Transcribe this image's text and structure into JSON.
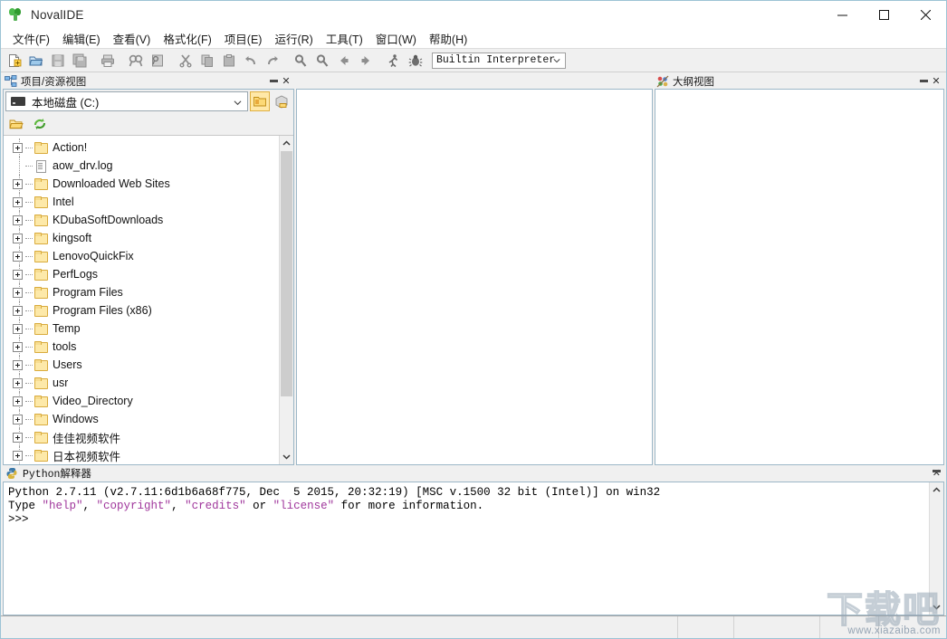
{
  "window": {
    "title": "NovalIDE",
    "app_icon": "sprout-icon",
    "controls": {
      "minimize": "–",
      "maximize": "□",
      "close": "✕"
    }
  },
  "menubar": {
    "items": [
      {
        "label": "文件(F)",
        "name": "menu-file"
      },
      {
        "label": "编辑(E)",
        "name": "menu-edit"
      },
      {
        "label": "查看(V)",
        "name": "menu-view"
      },
      {
        "label": "格式化(F)",
        "name": "menu-format"
      },
      {
        "label": "项目(E)",
        "name": "menu-project"
      },
      {
        "label": "运行(R)",
        "name": "menu-run"
      },
      {
        "label": "工具(T)",
        "name": "menu-tools"
      },
      {
        "label": "窗口(W)",
        "name": "menu-window"
      },
      {
        "label": "帮助(H)",
        "name": "menu-help"
      }
    ]
  },
  "toolbar": {
    "buttons": [
      {
        "icon": "new-file-icon",
        "name": "toolbar-new-file"
      },
      {
        "icon": "open-folder-icon",
        "name": "toolbar-open"
      },
      {
        "icon": "save-icon",
        "name": "toolbar-save"
      },
      {
        "icon": "save-all-icon",
        "name": "toolbar-save-all"
      },
      {
        "icon": "print-icon",
        "name": "toolbar-print"
      },
      {
        "icon": "find-icon",
        "name": "toolbar-find"
      },
      {
        "icon": "replace-icon",
        "name": "toolbar-replace"
      },
      {
        "icon": "cut-icon",
        "name": "toolbar-cut"
      },
      {
        "icon": "copy-icon",
        "name": "toolbar-copy"
      },
      {
        "icon": "paste-icon",
        "name": "toolbar-paste"
      },
      {
        "icon": "undo-icon",
        "name": "toolbar-undo"
      },
      {
        "icon": "redo-icon",
        "name": "toolbar-redo"
      },
      {
        "icon": "zoom-in-icon",
        "name": "toolbar-zoom-in"
      },
      {
        "icon": "zoom-out-icon",
        "name": "toolbar-zoom-out"
      },
      {
        "icon": "back-arrow-icon",
        "name": "toolbar-back"
      },
      {
        "icon": "forward-arrow-icon",
        "name": "toolbar-forward"
      },
      {
        "icon": "run-icon",
        "name": "toolbar-run"
      },
      {
        "icon": "debug-bug-icon",
        "name": "toolbar-debug"
      }
    ],
    "interpreter": {
      "value": "Builtin Interpreter",
      "arrow_icon": "chevron-down-icon"
    }
  },
  "project_panel": {
    "title": "项目/资源视图",
    "icon": "project-view-icon",
    "minimize": "minimize-icon",
    "close": "close-icon",
    "drive": {
      "value": "本地磁盘 (C:)",
      "icon": "drive-icon",
      "arrow_icon": "chevron-down-icon"
    },
    "drive_buttons": [
      {
        "icon": "folder-yellow-icon",
        "name": "drive-browse-button",
        "selected": true
      },
      {
        "icon": "package-icon",
        "name": "drive-package-button",
        "selected": false
      }
    ],
    "mini_toolbar": [
      {
        "icon": "open-folder-icon",
        "name": "tree-open-folder-button"
      },
      {
        "icon": "refresh-icon",
        "name": "tree-refresh-button"
      }
    ],
    "tree": [
      {
        "label": "Action!",
        "type": "folder",
        "expandable": true
      },
      {
        "label": "aow_drv.log",
        "type": "file",
        "expandable": false
      },
      {
        "label": "Downloaded Web Sites",
        "type": "folder",
        "expandable": true
      },
      {
        "label": "Intel",
        "type": "folder",
        "expandable": true
      },
      {
        "label": "KDubaSoftDownloads",
        "type": "folder",
        "expandable": true
      },
      {
        "label": "kingsoft",
        "type": "folder",
        "expandable": true
      },
      {
        "label": "LenovoQuickFix",
        "type": "folder",
        "expandable": true
      },
      {
        "label": "PerfLogs",
        "type": "folder",
        "expandable": true
      },
      {
        "label": "Program Files",
        "type": "folder",
        "expandable": true
      },
      {
        "label": "Program Files (x86)",
        "type": "folder",
        "expandable": true
      },
      {
        "label": "Temp",
        "type": "folder",
        "expandable": true
      },
      {
        "label": "tools",
        "type": "folder",
        "expandable": true
      },
      {
        "label": "Users",
        "type": "folder",
        "expandable": true
      },
      {
        "label": "usr",
        "type": "folder",
        "expandable": true
      },
      {
        "label": "Video_Directory",
        "type": "folder",
        "expandable": true
      },
      {
        "label": "Windows",
        "type": "folder",
        "expandable": true
      },
      {
        "label": "佳佳视频软件",
        "type": "folder",
        "expandable": true
      },
      {
        "label": "日本视频软件",
        "type": "folder",
        "expandable": true
      }
    ],
    "scrollbar": {
      "up_arrow": "chevron-up-icon",
      "down_arrow": "chevron-down-icon"
    }
  },
  "outline_panel": {
    "title": "大纲视图",
    "icon": "outline-view-icon",
    "minimize": "minimize-icon",
    "close": "close-icon"
  },
  "editor": {
    "content": ""
  },
  "console_panel": {
    "title": "Python解释器",
    "icon": "python-icon",
    "minimize": "minimize-icon",
    "close": "close-icon",
    "lines": [
      {
        "segments": [
          {
            "text": "Python 2.7.11 (v2.7.11:6d1b6a68f775, Dec  5 2015, 20:32:19) [MSC v.1500 32 bit (Intel)] on win32",
            "style": "plain"
          }
        ]
      },
      {
        "segments": [
          {
            "text": "Type ",
            "style": "plain"
          },
          {
            "text": "\"help\"",
            "style": "string"
          },
          {
            "text": ", ",
            "style": "plain"
          },
          {
            "text": "\"copyright\"",
            "style": "string"
          },
          {
            "text": ", ",
            "style": "plain"
          },
          {
            "text": "\"credits\"",
            "style": "string"
          },
          {
            "text": " or ",
            "style": "plain"
          },
          {
            "text": "\"license\"",
            "style": "string"
          },
          {
            "text": " for more information.",
            "style": "plain"
          }
        ]
      },
      {
        "segments": [
          {
            "text": ">>>",
            "style": "plain"
          }
        ]
      }
    ],
    "scrollbar": {
      "up_arrow": "chevron-up-icon",
      "down_arrow": "chevron-down-icon"
    }
  },
  "statusbar": {
    "cells": [
      "",
      "",
      "",
      "",
      ""
    ]
  },
  "watermark": {
    "big": "下载吧",
    "small": "www.xiazaiba.com"
  },
  "colors": {
    "window_border": "#9cc3d5",
    "panel_bg": "#f0f0f0",
    "string_purple": "#a0379c",
    "folder_yellow": "#fde9a9",
    "accent_select": "#ffe8a8"
  }
}
